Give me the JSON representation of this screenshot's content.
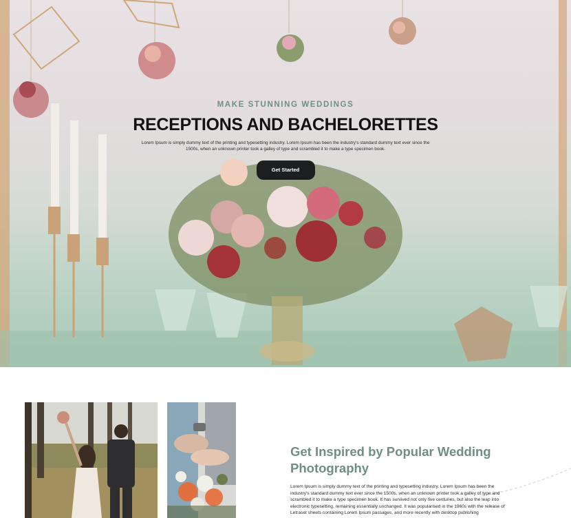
{
  "hero": {
    "eyebrow": "MAKE STUNNING WEDDINGS",
    "headline": "RECEPTIONS AND BACHELORETTES",
    "description": "Lorem Ipsum is simply dummy text of the printing and typesetting industry. Lorem Ipsum has been the industry's standard dummy text ever since the 1500s, when an unknown printer took a galley of type and scrambled it to make a type specimen book.",
    "cta_label": "Get Started"
  },
  "inspire": {
    "title": "Get Inspired by Popular Wedding Photography",
    "body": "Lorem Ipsum is simply dummy text of the printing and typesetting industry. Lorem Ipsum has been the industry's standard dummy text ever since the 1500s, when an unknown printer took a galley of type and scrambled it to make a type specimen book. It has survived not only five centuries, but also the leap into electronic typesetting, remaining essentially unchanged. It was popularised in the 1960s with the release of Letraset sheets containing Lorem Ipsum passages, and more recently with desktop publishing"
  },
  "colors": {
    "accent_green": "#6f8f80",
    "button_dark": "#1b1f1f",
    "hero_mint": "#b9d2c3"
  }
}
